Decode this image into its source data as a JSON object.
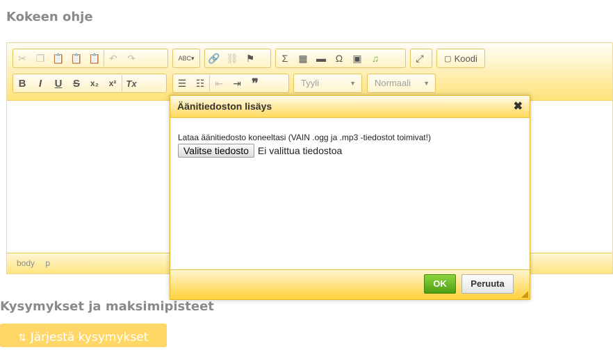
{
  "section1_title": "Kokeen ohje",
  "section2_title": "Kysymykset ja maksimipisteet",
  "toolbar": {
    "row1": {
      "clipboard": [
        "scissors-icon",
        "copy-icon",
        "paste-icon",
        "paste-text-icon",
        "paste-word-icon"
      ],
      "undo": [
        "undo-icon",
        "redo-icon"
      ],
      "spellcheck_label": "ABC",
      "links": [
        "link-icon",
        "unlink-icon",
        "anchor-icon"
      ],
      "insert": [
        "sigma-icon",
        "table-icon",
        "hr-icon",
        "omega-icon",
        "image-icon",
        "music-icon"
      ],
      "maximize": "maximize-icon",
      "source_label": "Koodi"
    },
    "row2": {
      "bold": "B",
      "italic": "I",
      "underline": "U",
      "strike": "S",
      "subscript": "x₂",
      "superscript": "x²",
      "remove_format": "Tx",
      "style_placeholder": "Tyyli",
      "format_placeholder": "Normaali"
    }
  },
  "statusbar": {
    "path": [
      "body",
      "p"
    ]
  },
  "dialog": {
    "title": "Äänitiedoston lisäys",
    "close": "✖",
    "instruction": "Lataa äänitiedosto koneeltasi (VAIN .ogg ja .mp3 -tiedostot toimivat!)",
    "file_button": "Valitse tiedosto",
    "no_file_text": "Ei valittua tiedostoa",
    "ok": "OK",
    "cancel": "Peruuta"
  },
  "sort_button_label": "Järjestä kysymykset",
  "colors": {
    "accent": "#ffd766",
    "ok_green": "#5bb21a",
    "toolbar": "#ffe27a"
  }
}
